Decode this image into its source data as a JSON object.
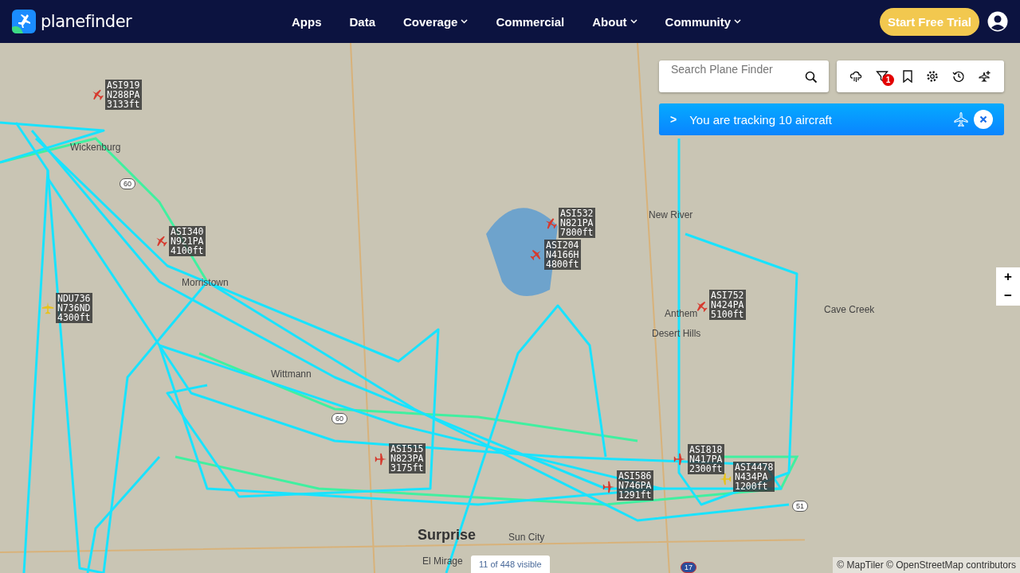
{
  "header": {
    "logo_text": "planefinder",
    "nav": [
      {
        "label": "Apps",
        "dropdown": false
      },
      {
        "label": "Data",
        "dropdown": false
      },
      {
        "label": "Coverage",
        "dropdown": true
      },
      {
        "label": "Commercial",
        "dropdown": false
      },
      {
        "label": "About",
        "dropdown": true
      },
      {
        "label": "Community",
        "dropdown": true
      }
    ],
    "cta": "Start Free Trial"
  },
  "search": {
    "placeholder": "Search Plane Finder"
  },
  "toolbar": {
    "filter_badge": "1"
  },
  "tracking_banner": {
    "text": "You are tracking 10 aircraft",
    "expand_glyph": ">"
  },
  "map": {
    "places": [
      {
        "name": "Wickenburg",
        "kind": "town"
      },
      {
        "name": "Morristown",
        "kind": "town"
      },
      {
        "name": "Wittmann",
        "kind": "town"
      },
      {
        "name": "New River",
        "kind": "town"
      },
      {
        "name": "Anthem",
        "kind": "town"
      },
      {
        "name": "Desert Hills",
        "kind": "town"
      },
      {
        "name": "Cave Creek",
        "kind": "town"
      },
      {
        "name": "Surprise",
        "kind": "city"
      },
      {
        "name": "Sun City",
        "kind": "town"
      },
      {
        "name": "El Mirage",
        "kind": "town"
      }
    ],
    "shields": [
      {
        "number": "60",
        "kind": "state"
      },
      {
        "number": "17",
        "kind": "interstate"
      },
      {
        "number": "51",
        "kind": "state"
      },
      {
        "number": "60",
        "kind": "state"
      }
    ],
    "aircraft": [
      {
        "callsign": "ASI919",
        "registration": "N288PA",
        "altitude": "3133ft",
        "color": "#d63a2e"
      },
      {
        "callsign": "ASI340",
        "registration": "N921PA",
        "altitude": "4100ft",
        "color": "#d63a2e"
      },
      {
        "callsign": "NDU736",
        "registration": "N736ND",
        "altitude": "4300ft",
        "color": "#e8c21c"
      },
      {
        "callsign": "ASI532",
        "registration": "N821PA",
        "altitude": "7800ft",
        "color": "#d63a2e"
      },
      {
        "callsign": "ASI204",
        "registration": "N4166H",
        "altitude": "4800ft",
        "color": "#d63a2e"
      },
      {
        "callsign": "ASI752",
        "registration": "N424PA",
        "altitude": "5100ft",
        "color": "#d63a2e"
      },
      {
        "callsign": "ASI515",
        "registration": "N823PA",
        "altitude": "3175ft",
        "color": "#d63a2e"
      },
      {
        "callsign": "ASI818",
        "registration": "N417PA",
        "altitude": "2300ft",
        "color": "#d63a2e"
      },
      {
        "callsign": "ASI586",
        "registration": "N746PA",
        "altitude": "1291ft",
        "color": "#d63a2e"
      },
      {
        "callsign": "ASI4478",
        "registration": "N434PA",
        "altitude": "1200ft",
        "color": "#e8c21c"
      }
    ],
    "zoom_in": "+",
    "zoom_out": "−",
    "visible_count": "11 of 448 visible",
    "attribution": "© MapTiler © OpenStreetMap contributors"
  }
}
